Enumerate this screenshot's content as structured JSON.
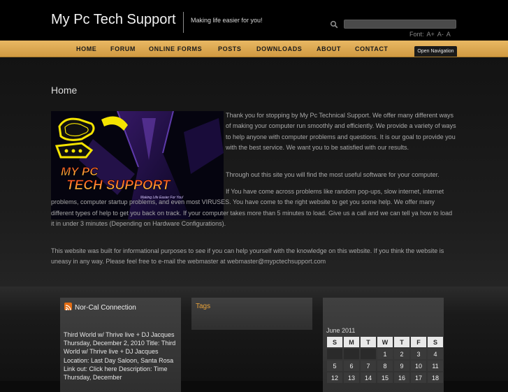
{
  "header": {
    "site_title": "My Pc Tech Support",
    "tagline": "Making life easier for you!",
    "search_placeholder": "",
    "font_label": "Font:",
    "font_increase": "A+",
    "font_decrease": "A-",
    "font_reset": "A"
  },
  "nav": {
    "items": [
      "HOME",
      "FORUM",
      "ONLINE FORMS",
      "POSTS",
      "DOWNLOADS",
      "ABOUT",
      "CONTACT"
    ],
    "open_navigation": "Open Navigation"
  },
  "main": {
    "page_title": "Home",
    "logo_text_line1": "MY PC",
    "logo_text_line2": "TECH SUPPORT",
    "logo_text_line3": "Making Life Easier For You!",
    "paragraphs": [
      "Thank you for stopping by My Pc Technical Support. We offer many different ways of making your computer run smoothly and efficiently. We provide a variety of ways to help anyone with computer problems and questions. It is our goal to provide you with the best service. We want you to be satisfied with our results.",
      "Through out this site you will find the most useful software for your computer.",
      "If You have come across problems like random pop-ups, slow internet, internet problems, computer startup problems, and even most VIRUSES. You have come to the right website to get you some help. We offer many different types of help to get you back on track. If your computer takes more than 5 minutes to load. Give us a call and we can tell ya how to load it in under 3 minutes (Depending on Hardware Configurations).",
      "This website was built for informational purposes to see if you can help yourself with the knowledge on this website. If you think the website is uneasy in any way. Please feel free to e-mail the webmaster at webmaster@mypctechsupport.com"
    ]
  },
  "sidebar": {
    "rss_title": "Nor-Cal Connection",
    "rss_feed_text": "Third World w/ Thrive live + DJ Jacques Thursday, December 2, 2010 Title: Third World w/ Thrive live + DJ Jacques Location: Last Day Saloon, Santa Rosa Link out: Click here Description: Time Thursday, December",
    "tags_title": "Tags",
    "calendar": {
      "caption": "June 2011",
      "weekdays": [
        "S",
        "M",
        "T",
        "W",
        "T",
        "F",
        "S"
      ],
      "week1": [
        "",
        "",
        "",
        "1",
        "2",
        "3",
        "4"
      ],
      "week2": [
        "5",
        "6",
        "7",
        "8",
        "9",
        "10",
        "11"
      ],
      "week3": [
        "12",
        "13",
        "14",
        "15",
        "16",
        "17",
        "18"
      ]
    }
  },
  "colors": {
    "nav_gold": "#e0aa52",
    "tags_title": "#e8a23a",
    "background": "#0b0b0b"
  }
}
